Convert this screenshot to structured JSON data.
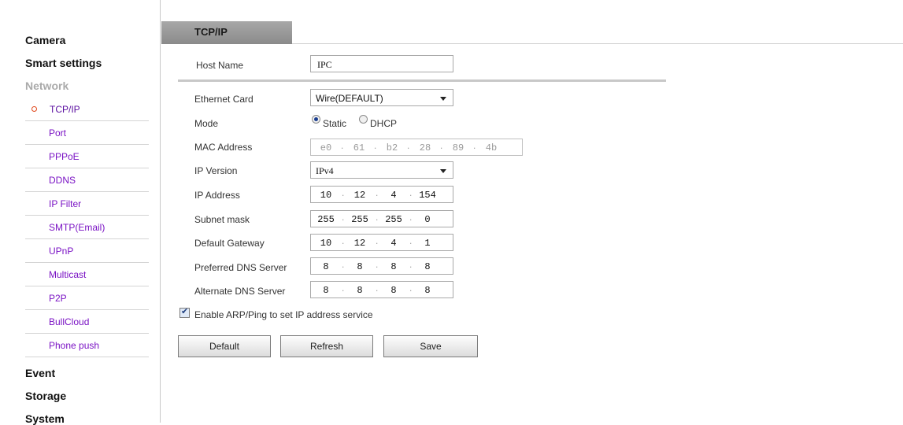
{
  "sidebar": {
    "camera": "Camera",
    "smart_settings": "Smart settings",
    "network": "Network",
    "network_items": [
      "TCP/IP",
      "Port",
      "PPPoE",
      "DDNS",
      "IP Filter",
      "SMTP(Email)",
      "UPnP",
      "Multicast",
      "P2P",
      "BullCloud",
      "Phone push"
    ],
    "event": "Event",
    "storage": "Storage",
    "system": "System"
  },
  "tab": {
    "label": "TCP/IP"
  },
  "form": {
    "host_name": {
      "label": "Host Name",
      "value": "IPC"
    },
    "ethernet_card": {
      "label": "Ethernet Card",
      "value": "Wire(DEFAULT)"
    },
    "mode": {
      "label": "Mode",
      "static": "Static",
      "dhcp": "DHCP",
      "selected": "Static"
    },
    "mac": {
      "label": "MAC Address",
      "octets": [
        "e0",
        "61",
        "b2",
        "28",
        "89",
        "4b"
      ]
    },
    "ip_version": {
      "label": "IP Version",
      "value": "IPv4"
    },
    "ip_address": {
      "label": "IP Address",
      "octets": [
        "10",
        "12",
        "4",
        "154"
      ]
    },
    "subnet": {
      "label": "Subnet mask",
      "octets": [
        "255",
        "255",
        "255",
        "0"
      ]
    },
    "gateway": {
      "label": "Default Gateway",
      "octets": [
        "10",
        "12",
        "4",
        "1"
      ]
    },
    "dns1": {
      "label": "Preferred DNS Server",
      "octets": [
        "8",
        "8",
        "8",
        "8"
      ]
    },
    "dns2": {
      "label": "Alternate DNS Server",
      "octets": [
        "8",
        "8",
        "8",
        "8"
      ]
    },
    "arp": {
      "label": "Enable ARP/Ping to set IP address service",
      "checked": true
    }
  },
  "buttons": {
    "default": "Default",
    "refresh": "Refresh",
    "save": "Save"
  },
  "colors": {
    "link": "#7a12c4",
    "selected_dot": "#e0481c",
    "tab": "#9a9a9a"
  }
}
